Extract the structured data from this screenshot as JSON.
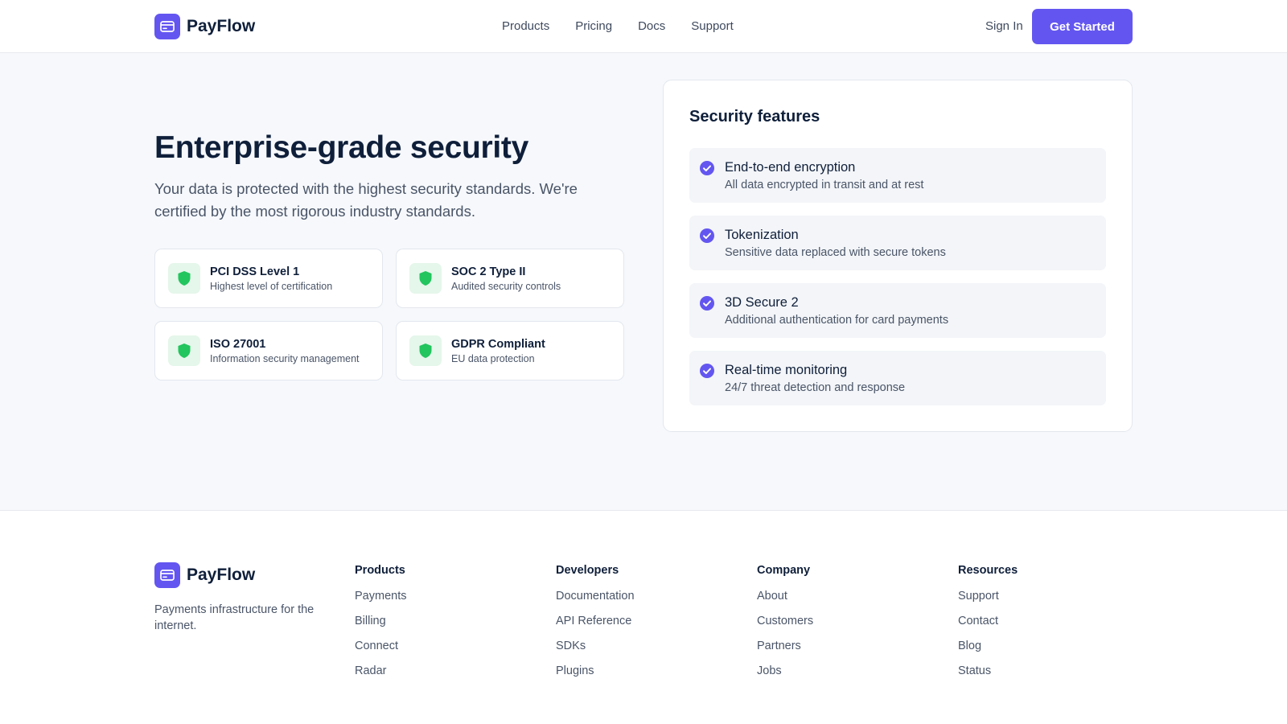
{
  "header": {
    "brand": "PayFlow",
    "nav": [
      "Products",
      "Pricing",
      "Docs",
      "Support"
    ],
    "sign_in": "Sign In",
    "cta": "Get Started"
  },
  "hero": {
    "title": "Enterprise-grade security",
    "subtitle": "Your data is protected with the highest security standards. We're certified by the most rigorous industry standards.",
    "certifications": [
      {
        "title": "PCI DSS Level 1",
        "desc": "Highest level of certification"
      },
      {
        "title": "SOC 2 Type II",
        "desc": "Audited security controls"
      },
      {
        "title": "ISO 27001",
        "desc": "Information security management"
      },
      {
        "title": "GDPR Compliant",
        "desc": "EU data protection"
      }
    ]
  },
  "features": {
    "title": "Security features",
    "items": [
      {
        "title": "End-to-end encryption",
        "desc": "All data encrypted in transit and at rest"
      },
      {
        "title": "Tokenization",
        "desc": "Sensitive data replaced with secure tokens"
      },
      {
        "title": "3D Secure 2",
        "desc": "Additional authentication for card payments"
      },
      {
        "title": "Real-time monitoring",
        "desc": "24/7 threat detection and response"
      }
    ]
  },
  "footer": {
    "brand": "PayFlow",
    "tagline": "Payments infrastructure for the internet.",
    "columns": [
      {
        "title": "Products",
        "links": [
          "Payments",
          "Billing",
          "Connect",
          "Radar"
        ]
      },
      {
        "title": "Developers",
        "links": [
          "Documentation",
          "API Reference",
          "SDKs",
          "Plugins"
        ]
      },
      {
        "title": "Company",
        "links": [
          "About",
          "Customers",
          "Partners",
          "Jobs"
        ]
      },
      {
        "title": "Resources",
        "links": [
          "Support",
          "Contact",
          "Blog",
          "Status"
        ]
      }
    ]
  },
  "colors": {
    "accent": "#6356f0",
    "success": "#22c55e",
    "text": "#0f1f3a",
    "muted": "#4a5568"
  },
  "icons": {
    "logo": "credit-card-icon",
    "certification": "shield-icon",
    "feature": "check-circle-icon"
  }
}
